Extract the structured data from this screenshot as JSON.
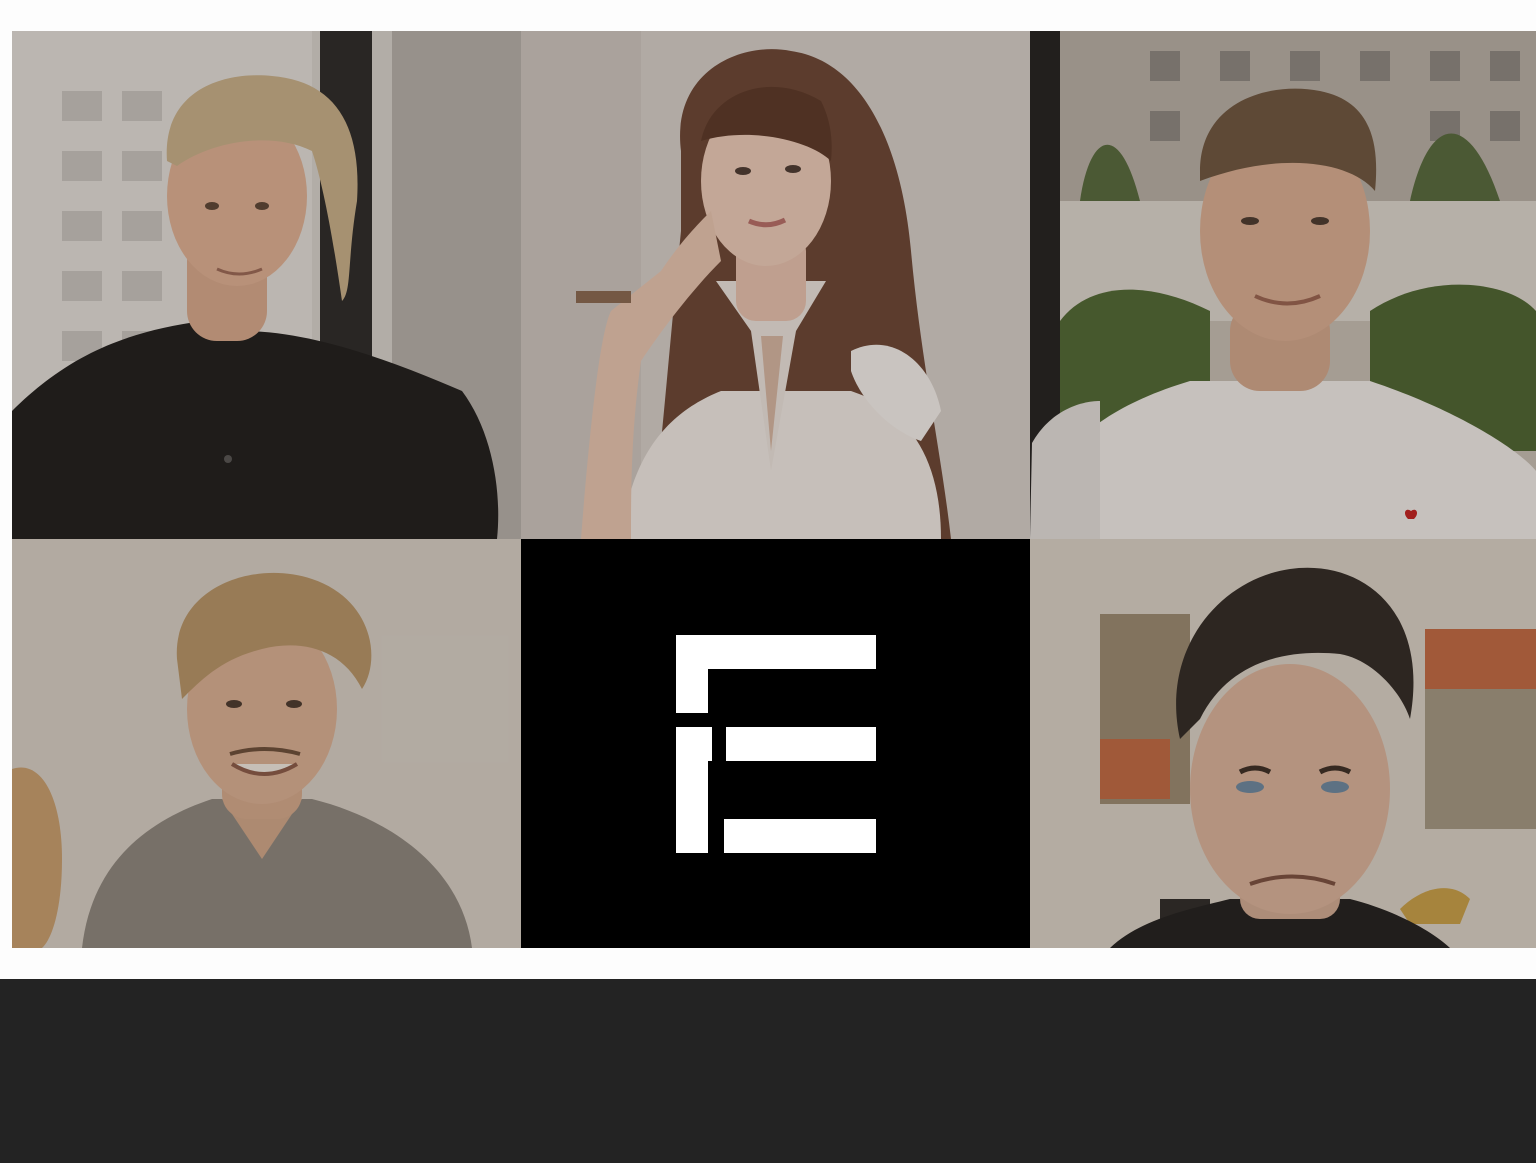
{
  "colors": {
    "page_background": "#fdfdfd",
    "footer_background": "#232323",
    "logo_background": "#000000",
    "logo_mark": "#ffffff"
  },
  "team_photos": [
    {
      "name": "team-photo-man-black-polo"
    },
    {
      "name": "team-photo-woman-white-blouse"
    },
    {
      "name": "team-photo-man-white-tshirt"
    },
    {
      "name": "team-photo-man-curly-hair"
    },
    {
      "name": "team-photo-man-dark-hair"
    }
  ],
  "logo": {
    "icon": "f-e-logo-icon"
  }
}
